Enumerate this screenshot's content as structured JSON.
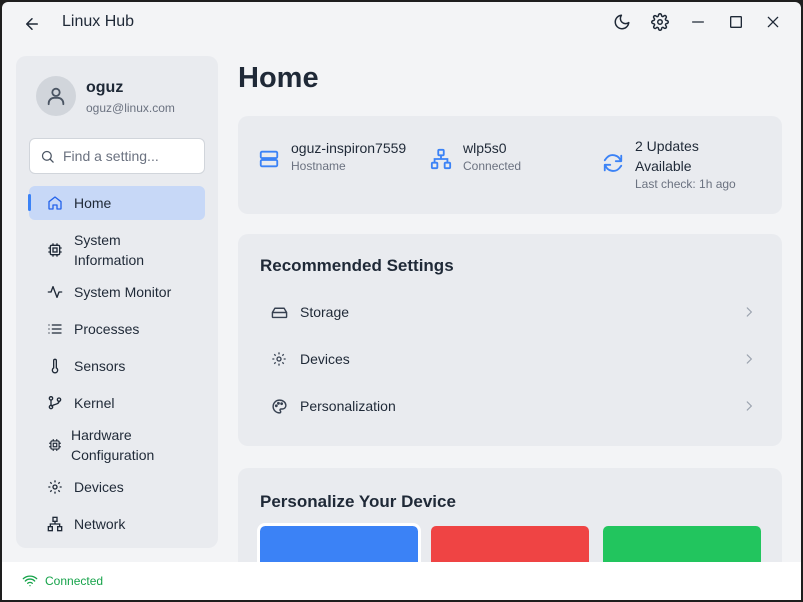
{
  "app": {
    "title": "Linux Hub"
  },
  "titlebar": {
    "icons": [
      "back-arrow-icon",
      "moon-icon",
      "gear-icon",
      "minimize-icon",
      "maximize-icon",
      "close-icon"
    ]
  },
  "user": {
    "name": "oguz",
    "email": "oguz@linux.com"
  },
  "search": {
    "placeholder": "Find a setting..."
  },
  "sidebar": {
    "items": [
      {
        "label": "Home",
        "icon": "home-icon",
        "active": true
      },
      {
        "label": "System\nInformation",
        "icon": "chip-icon"
      },
      {
        "label": "System Monitor",
        "icon": "activity-icon"
      },
      {
        "label": "Processes",
        "icon": "list-icon"
      },
      {
        "label": "Sensors",
        "icon": "thermometer-icon"
      },
      {
        "label": "Kernel",
        "icon": "git-branch-icon"
      },
      {
        "label": "Hardware\nConfiguration",
        "icon": "cpu-icon"
      },
      {
        "label": "Devices",
        "icon": "gear-icon"
      },
      {
        "label": "Network",
        "icon": "network-icon"
      }
    ]
  },
  "main": {
    "title": "Home",
    "info": {
      "hostname": {
        "value": "oguz-inspiron7559",
        "label": "Hostname"
      },
      "network": {
        "value": "wlp5s0",
        "label": "Connected"
      },
      "updates": {
        "value": "2 Updates Available",
        "label": "Last check: 1h ago"
      }
    },
    "recommended": {
      "title": "Recommended Settings",
      "items": [
        {
          "label": "Storage",
          "icon": "hard-drive-icon"
        },
        {
          "label": "Devices",
          "icon": "gear-icon"
        },
        {
          "label": "Personalization",
          "icon": "palette-icon"
        }
      ]
    },
    "personalize": {
      "title": "Personalize Your Device",
      "colors": [
        "#3b82f6",
        "#ef4444",
        "#22c55e"
      ]
    }
  },
  "status": {
    "text": "Connected",
    "icon": "wifi-icon",
    "color": "#16a34a"
  },
  "colors": {
    "accent": "#3b82f6",
    "active_bg": "#c7d8f7",
    "sidebar_bg": "#e9ebef"
  }
}
